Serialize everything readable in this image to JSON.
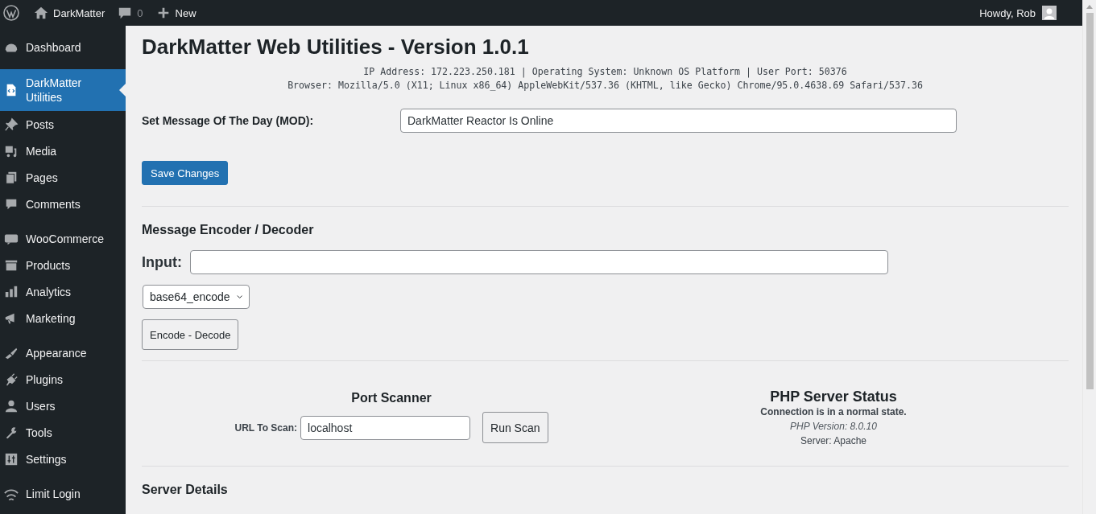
{
  "admin_bar": {
    "site_name": "DarkMatter",
    "comment_count": "0",
    "new_label": "New",
    "greeting": "Howdy, Rob"
  },
  "sidebar": {
    "groups": [
      {
        "items": [
          {
            "label": "Dashboard",
            "selected": false
          }
        ]
      },
      {
        "items": [
          {
            "label": "DarkMatter Utilities",
            "selected": true
          },
          {
            "label": "Posts",
            "selected": false
          },
          {
            "label": "Media",
            "selected": false
          },
          {
            "label": "Pages",
            "selected": false
          },
          {
            "label": "Comments",
            "selected": false
          }
        ]
      },
      {
        "items": [
          {
            "label": "WooCommerce",
            "selected": false
          },
          {
            "label": "Products",
            "selected": false
          },
          {
            "label": "Analytics",
            "selected": false
          },
          {
            "label": "Marketing",
            "selected": false
          }
        ]
      },
      {
        "items": [
          {
            "label": "Appearance",
            "selected": false
          },
          {
            "label": "Plugins",
            "selected": false
          },
          {
            "label": "Users",
            "selected": false
          },
          {
            "label": "Tools",
            "selected": false
          },
          {
            "label": "Settings",
            "selected": false
          }
        ]
      },
      {
        "items": [
          {
            "label": "Limit Login",
            "selected": false
          }
        ]
      }
    ]
  },
  "page": {
    "title": "DarkMatter Web Utilities - Version 1.0.1",
    "info_lines": [
      "IP Address: 172.223.250.181 | Operating System: Unknown OS Platform | User Port: 50376",
      "Browser: Mozilla/5.0 (X11; Linux x86_64) AppleWebKit/537.36 (KHTML, like Gecko) Chrome/95.0.4638.69 Safari/537.36"
    ],
    "mod": {
      "label": "Set Message Of The Day (MOD):",
      "value": "DarkMatter Reactor Is Online"
    },
    "save_button": "Save Changes",
    "encoder": {
      "heading": "Message Encoder / Decoder",
      "input_label": "Input:",
      "mode": "base64_encode",
      "button": "Encode - Decode"
    },
    "port_scanner": {
      "heading": "Port Scanner",
      "url_label": "URL To Scan:",
      "url_value": "localhost",
      "button": "Run Scan"
    },
    "server_status": {
      "heading": "PHP Server Status",
      "connection": "Connection is in a normal state.",
      "php_version": "PHP Version: 8.0.10",
      "server": "Server: Apache"
    },
    "server_details": {
      "heading": "Server Details"
    }
  }
}
